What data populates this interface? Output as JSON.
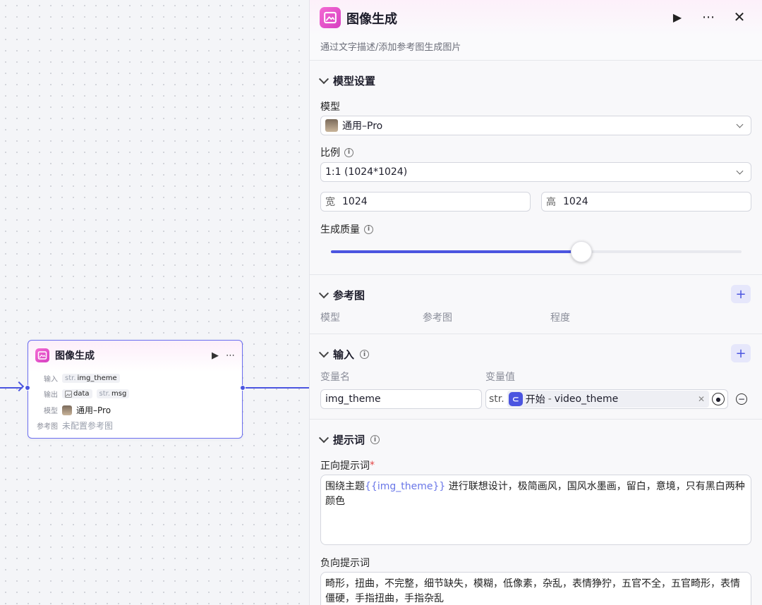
{
  "canvas_node": {
    "title": "图像生成",
    "input_label": "输入",
    "input_type": "str.",
    "input_value": "img_theme",
    "output_label": "输出",
    "output_1": "data",
    "output_2_type": "str.",
    "output_2": "msg",
    "model_label": "模型",
    "model_value": "通用–Pro",
    "ref_label": "参考图",
    "ref_value": "未配置参考图"
  },
  "panel": {
    "title": "图像生成",
    "description": "通过文字描述/添加参考图生成图片",
    "model_section": {
      "title": "模型设置",
      "model_label": "模型",
      "model_value": "通用–Pro",
      "ratio_label": "比例",
      "ratio_value": "1:1 (1024*1024)",
      "width_prefix": "宽",
      "width_value": "1024",
      "height_prefix": "高",
      "height_value": "1024",
      "quality_label": "生成质量",
      "quality_fraction": 0.61
    },
    "reference_section": {
      "title": "参考图",
      "col_model": "模型",
      "col_ref": "参考图",
      "col_degree": "程度"
    },
    "input_section": {
      "title": "输入",
      "col_name": "变量名",
      "col_value": "变量值",
      "var_name": "img_theme",
      "var_type": "str.",
      "ref_node": "开始",
      "ref_separator": " - ",
      "ref_var": "video_theme"
    },
    "prompt_section": {
      "title": "提示词",
      "positive_label": "正向提示词",
      "required_mark": "*",
      "positive_prefix": "围绕主题",
      "positive_var": "{{img_theme}}",
      "positive_suffix": " 进行联想设计，极简画风，国风水墨画，留白，意境，只有黑白两种颜色",
      "negative_label": "负向提示词",
      "negative_text": "畸形，扭曲，不完整，细节缺失，模糊，低像素，杂乱，表情狰狞，五官不全，五官畸形，表情僵硬，手指扭曲，手指杂乱"
    }
  },
  "colors": {
    "accent": "#4b55e0",
    "app_icon": "#e24fcb"
  }
}
